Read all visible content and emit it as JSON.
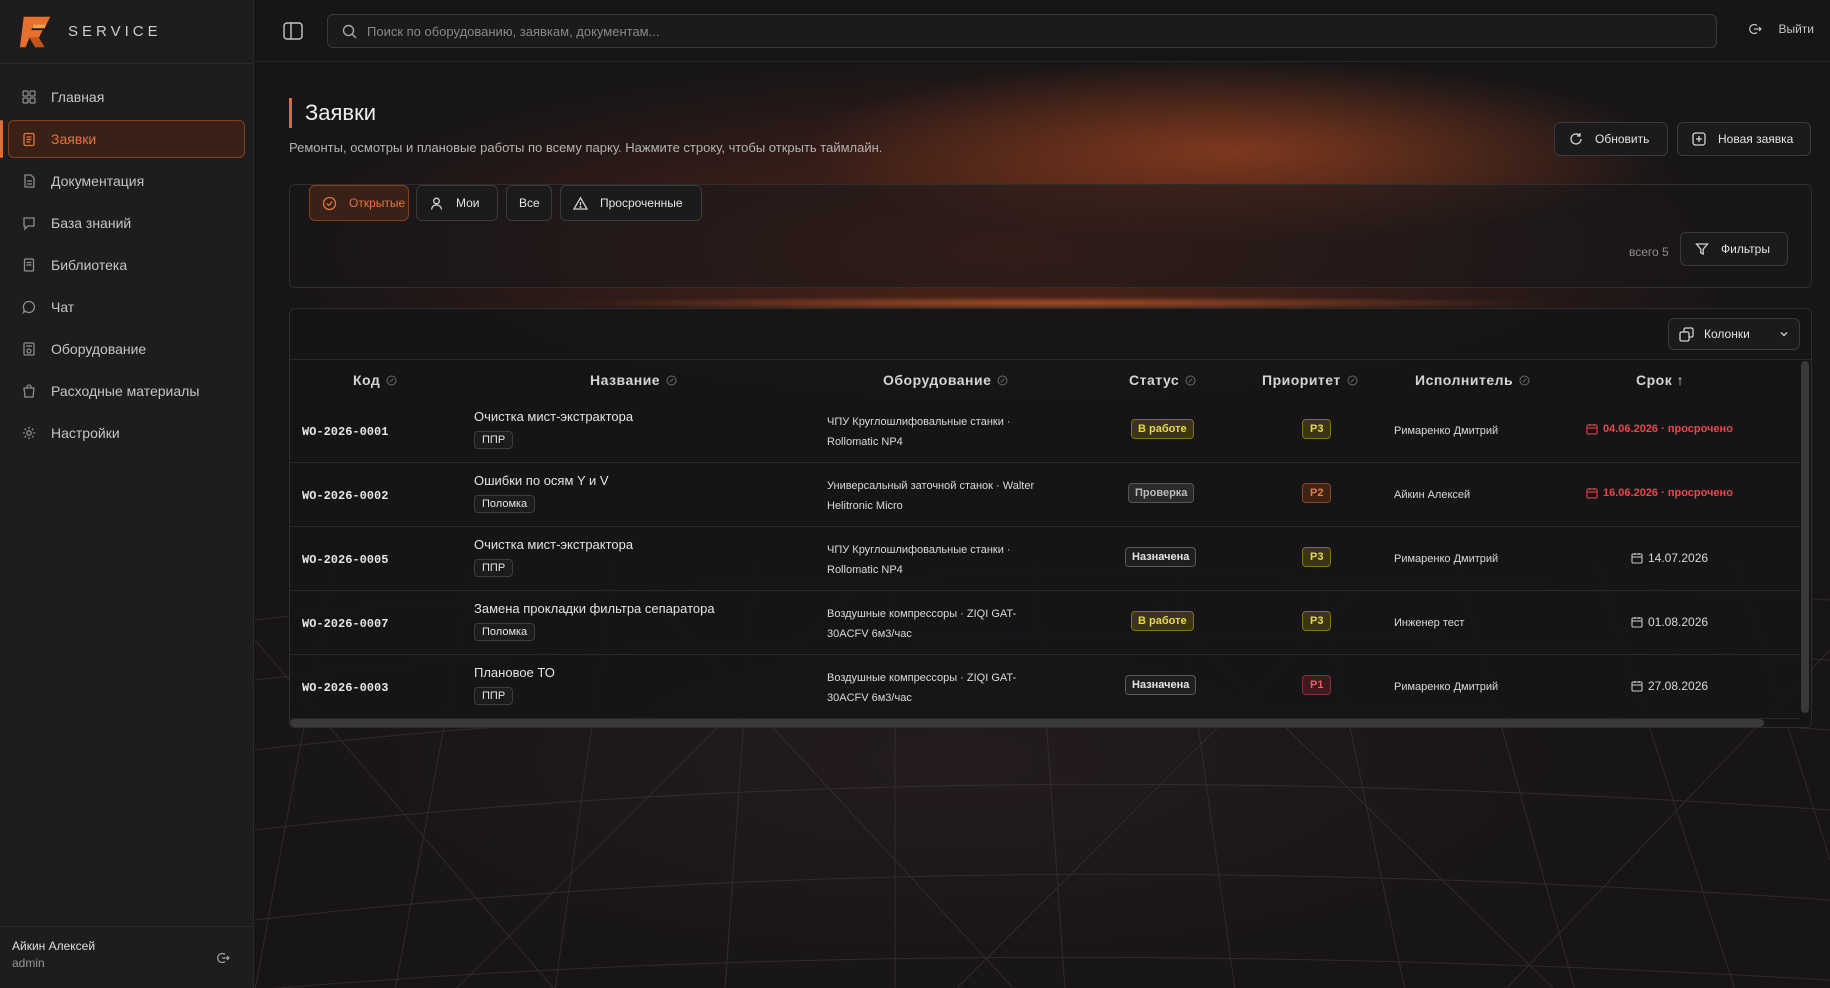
{
  "brand": {
    "name": "SERVICE"
  },
  "sidebar": {
    "items": [
      {
        "label": "Главная",
        "icon": "grid-icon"
      },
      {
        "label": "Заявки",
        "icon": "clipboard-icon",
        "active": true
      },
      {
        "label": "Документация",
        "icon": "docs-icon"
      },
      {
        "label": "База знаний",
        "icon": "chat-bubble-icon"
      },
      {
        "label": "Библиотека",
        "icon": "book-icon"
      },
      {
        "label": "Чат",
        "icon": "chat-icon"
      },
      {
        "label": "Оборудование",
        "icon": "device-icon"
      },
      {
        "label": "Расходные материалы",
        "icon": "bag-icon"
      },
      {
        "label": "Настройки",
        "icon": "gear-icon"
      }
    ]
  },
  "user": {
    "name": "Айкин Алексей",
    "role": "admin"
  },
  "topbar": {
    "search_placeholder": "Поиск по оборудованию, заявкам, документам...",
    "logout_label": "Выйти"
  },
  "page": {
    "title": "Заявки",
    "subtitle": "Ремонты, осмотры и плановые работы по всему парку. Нажмите строку, чтобы открыть таймлайн.",
    "refresh_label": "Обновить",
    "new_label": "Новая заявка"
  },
  "filters": {
    "tabs": [
      {
        "label": "Открытые",
        "active": true
      },
      {
        "label": "Мои"
      },
      {
        "label": "Все"
      },
      {
        "label": "Просроченные"
      }
    ],
    "count_label": "всего 5",
    "filters_label": "Фильтры"
  },
  "table": {
    "columns_label": "Колонки",
    "headers": [
      "Код",
      "Название",
      "Оборудование",
      "Статус",
      "Приоритет",
      "Исполнитель",
      "Срок ↑"
    ],
    "rows": [
      {
        "code": "WO-2026-0001",
        "name": "Очистка мист-экстрактора",
        "tag": "ППР",
        "equipment": "ЧПУ Круглошлифовальные станки · Rollomatic NP4",
        "status": "В работе",
        "status_kind": "work",
        "priority": "P3",
        "assignee": "Римаренко Дмитрий",
        "due": "04.06.2026 · просрочено",
        "overdue": true
      },
      {
        "code": "WO-2026-0002",
        "name": "Ошибки по осям Y и V",
        "tag": "Поломка",
        "equipment": "Универсальный заточной станок · Walter Helitronic Micro",
        "status": "Проверка",
        "status_kind": "check",
        "priority": "P2",
        "assignee": "Айкин Алексей",
        "due": "16.06.2026 · просрочено",
        "overdue": true
      },
      {
        "code": "WO-2026-0005",
        "name": "Очистка мист-экстрактора",
        "tag": "ППР",
        "equipment": "ЧПУ Круглошлифовальные станки · Rollomatic NP4",
        "status": "Назначена",
        "status_kind": "assign",
        "priority": "P3",
        "assignee": "Римаренко Дмитрий",
        "due": "14.07.2026",
        "overdue": false
      },
      {
        "code": "WO-2026-0007",
        "name": "Замена прокладки фильтра сепаратора",
        "tag": "Поломка",
        "equipment": "Воздушные компрессоры · ZIQI GAT-30ACFV 6м3/час",
        "status": "В работе",
        "status_kind": "work",
        "priority": "P3",
        "assignee": "Инженер тест",
        "due": "01.08.2026",
        "overdue": false
      },
      {
        "code": "WO-2026-0003",
        "name": "Плановое ТО",
        "tag": "ППР",
        "equipment": "Воздушные компрессоры · ZIQI GAT-30ACFV 6м3/час",
        "status": "Назначена",
        "status_kind": "assign",
        "priority": "P1",
        "assignee": "Римаренко Дмитрий",
        "due": "27.08.2026",
        "overdue": false
      }
    ]
  },
  "colors": {
    "accent": "#e26b2f",
    "overdue": "#e5484d"
  }
}
